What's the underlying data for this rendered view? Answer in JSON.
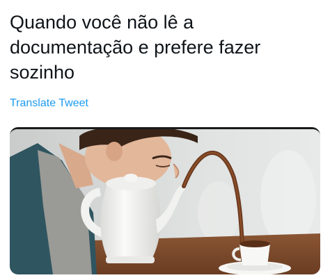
{
  "tweet": {
    "text_lines": [
      "Quando você não lê a",
      "documentação e prefere fazer",
      "sozinho"
    ],
    "translate_label": "Translate Tweet"
  },
  "media": {
    "icon": "photo-meme-man-drinking-coffee-from-teapot-spout",
    "colors": {
      "background_wall": "#d9dcdc",
      "table": "#7a4a2c",
      "teapot": "#f4f4f2",
      "coffee": "#6b3a1f",
      "jacket": "#2f5560",
      "shirt": "#9a9a96",
      "hair": "#3a2418",
      "skin": "#e3b79a"
    }
  },
  "colors": {
    "text": "#0f1419",
    "link": "#1d9bf0",
    "background": "#ffffff"
  }
}
